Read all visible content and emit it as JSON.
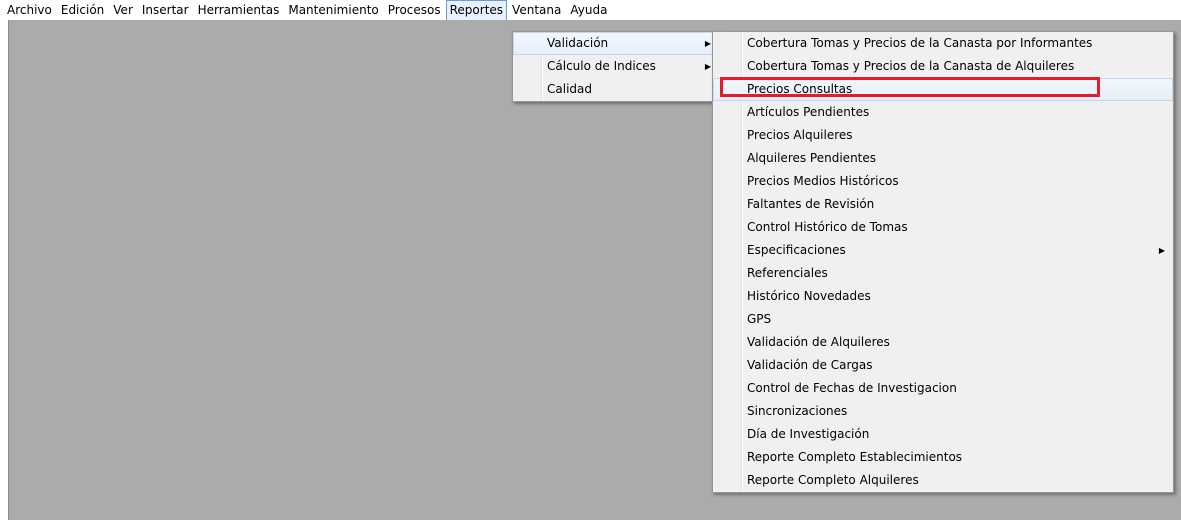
{
  "menubar": {
    "items": [
      "Archivo",
      "Edición",
      "Ver",
      "Insertar",
      "Herramientas",
      "Mantenimiento",
      "Procesos",
      "Reportes",
      "Ventana",
      "Ayuda"
    ]
  },
  "reportes_menu": {
    "items": [
      {
        "label": "Validación",
        "has_submenu": true
      },
      {
        "label": "Cálculo de Indices",
        "has_submenu": true
      },
      {
        "label": "Calidad",
        "has_submenu": false
      }
    ]
  },
  "validacion_submenu": {
    "items": [
      {
        "label": "Cobertura Tomas y Precios de la Canasta por Informantes"
      },
      {
        "label": "Cobertura Tomas y Precios de la Canasta de Alquileres"
      },
      {
        "label": "Precios Consultas"
      },
      {
        "label": "Artículos Pendientes"
      },
      {
        "label": "Precios Alquileres"
      },
      {
        "label": "Alquileres Pendientes"
      },
      {
        "label": "Precios Medios Históricos"
      },
      {
        "label": "Faltantes de Revisión"
      },
      {
        "label": "Control Histórico de Tomas"
      },
      {
        "label": "Especificaciones",
        "has_submenu": true
      },
      {
        "label": "Referenciales"
      },
      {
        "label": "Histórico Novedades"
      },
      {
        "label": "GPS"
      },
      {
        "label": "Validación de Alquileres"
      },
      {
        "label": "Validación de Cargas"
      },
      {
        "label": "Control de Fechas de Investigacion"
      },
      {
        "label": "Sincronizaciones"
      },
      {
        "label": "Día de Investigación"
      },
      {
        "label": "Reporte Completo Establecimientos"
      },
      {
        "label": "Reporte Completo Alquileres"
      }
    ]
  },
  "colors": {
    "workspace": "#ababab",
    "highlight_box": "#e41c2c",
    "menu_background": "#f0f0f0"
  }
}
